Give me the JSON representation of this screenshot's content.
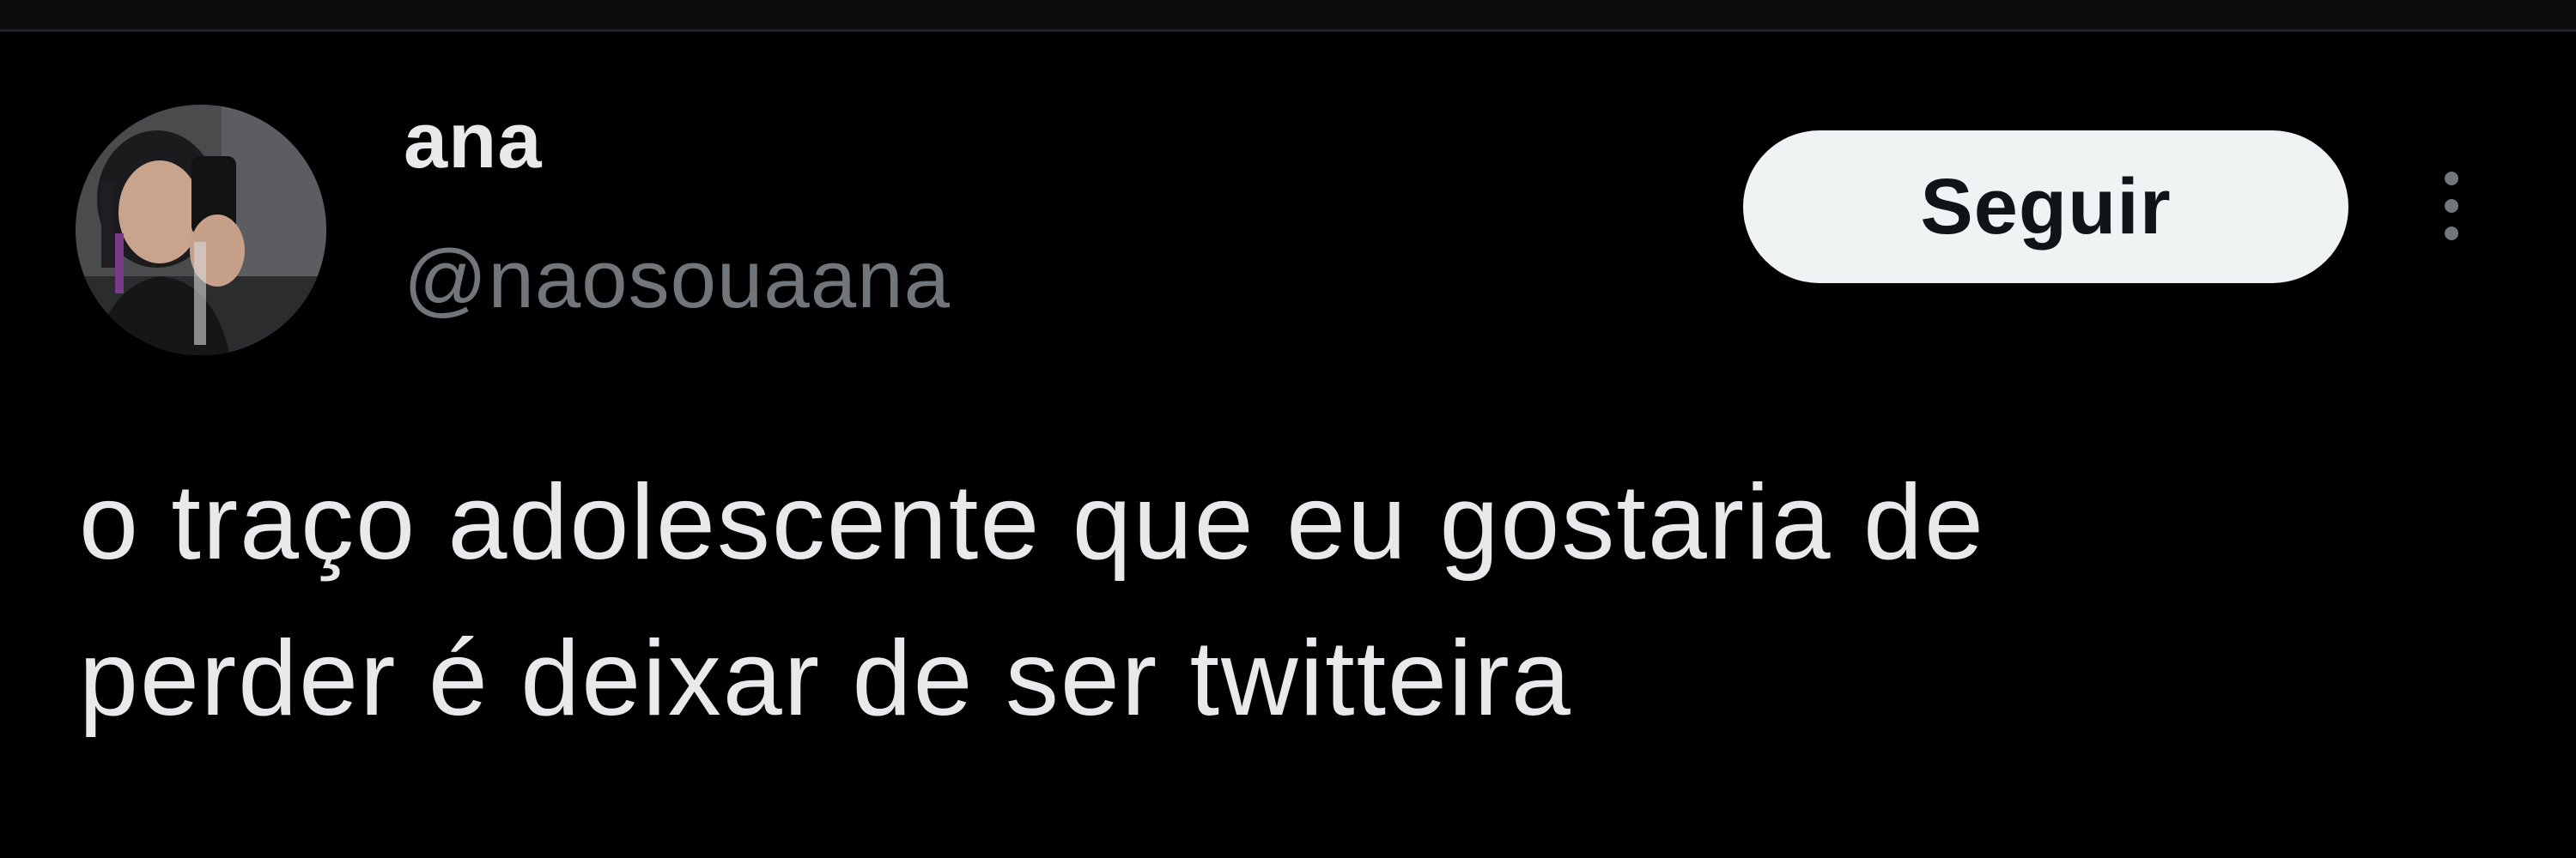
{
  "author": {
    "display_name": "ana",
    "handle": "@naosouaana"
  },
  "actions": {
    "follow_label": "Seguir"
  },
  "tweet": {
    "lines": [
      "o traço adolescente que eu gostaria de",
      "perder é deixar de ser twitteira"
    ]
  },
  "icons": {
    "more": "more-options-icon",
    "avatar": "avatar"
  },
  "colors": {
    "background": "#000000",
    "text_primary": "#e7e9ea",
    "text_secondary": "#71767b",
    "follow_button_bg": "#eff3f4",
    "follow_button_text": "#0f1419"
  }
}
